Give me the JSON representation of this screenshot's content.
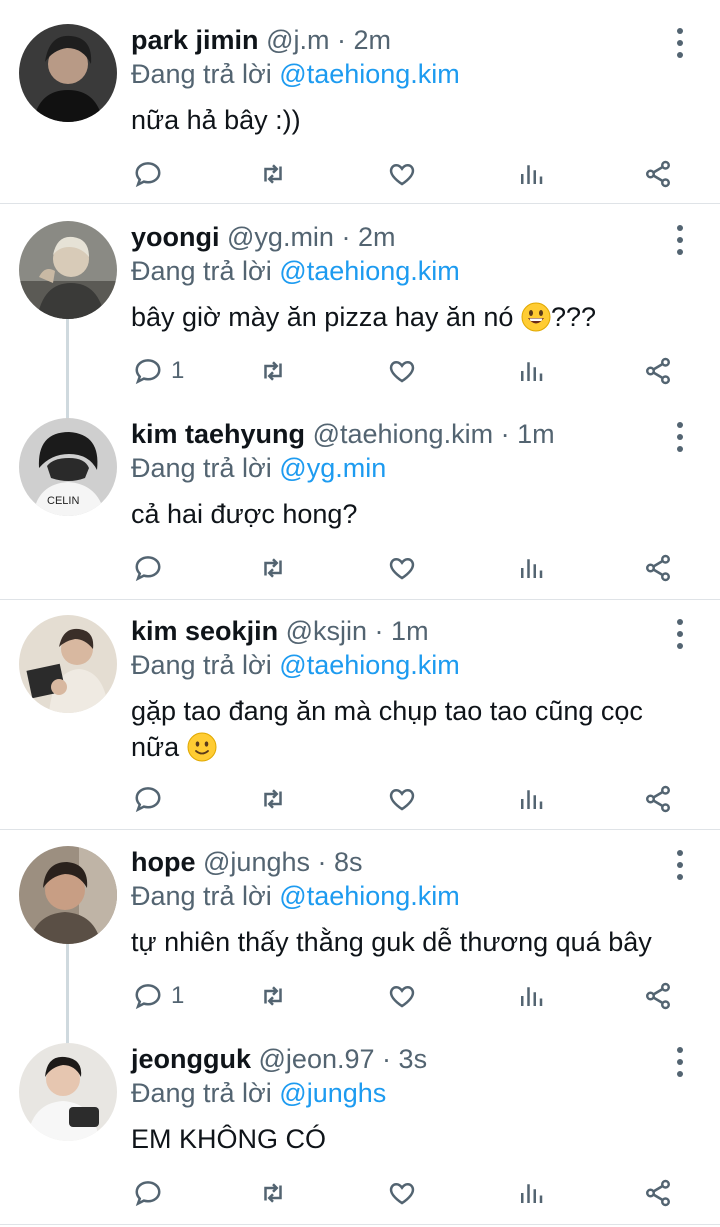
{
  "reply_prefix": "Đang trả lời",
  "colors": {
    "accent": "#1d9bf0",
    "secondary_text": "#536471",
    "divider": "#dfe3e7"
  },
  "action_icons": [
    "reply-icon",
    "retweet-icon",
    "like-icon",
    "views-icon",
    "share-icon"
  ],
  "tweets": [
    {
      "name": "park jimin",
      "handle": "@j.m",
      "time": "2m",
      "reply_to": "@taehiong.kim",
      "text": "nữa hả bây :))",
      "reply_count": ""
    },
    {
      "name": "yoongi",
      "handle": "@yg.min",
      "time": "2m",
      "reply_to": "@taehiong.kim",
      "text": "bây giờ mày ăn pizza hay ăn nó ",
      "text_after": "???",
      "emoji": "grinning-face",
      "reply_count": "1"
    },
    {
      "name": "kim taehyung",
      "handle": "@taehiong.kim",
      "time": "1m",
      "reply_to": "@yg.min",
      "text": "cả hai được hong?",
      "reply_count": ""
    },
    {
      "name": "kim seokjin",
      "handle": "@ksjin",
      "time": "1m",
      "reply_to": "@taehiong.kim",
      "text": "gặp tao đang ăn mà chụp tao tao cũng cọc nữa ",
      "emoji": "slightly-smiling-face",
      "reply_count": ""
    },
    {
      "name": "hope",
      "handle": "@junghs",
      "time": "8s",
      "reply_to": "@taehiong.kim",
      "text": "tự nhiên thấy thằng guk dễ thương quá bây",
      "reply_count": "1"
    },
    {
      "name": "jeongguk",
      "handle": "@jeon.97",
      "time": "3s",
      "reply_to": "@junghs",
      "text": "EM KHÔNG CÓ",
      "reply_count": ""
    }
  ]
}
